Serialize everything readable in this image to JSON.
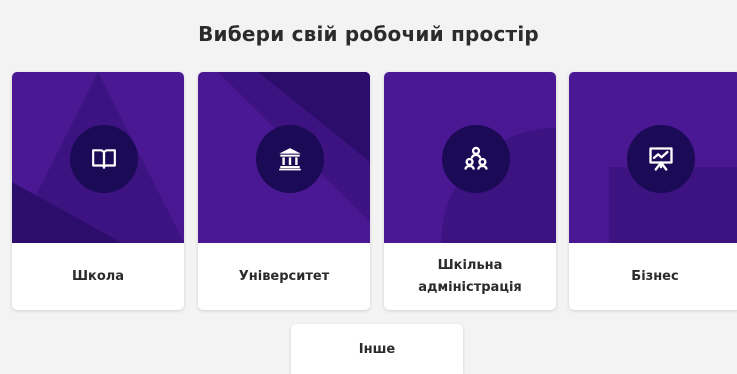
{
  "header": {
    "title": "Вибери свій робочий простір"
  },
  "workspaces": [
    {
      "label": "Школа",
      "icon": "book-icon"
    },
    {
      "label": "Університет",
      "icon": "university-building-icon"
    },
    {
      "label": "Шкільна адміністрація",
      "icon": "people-group-icon"
    },
    {
      "label": "Бізнес",
      "icon": "presentation-chart-icon"
    }
  ],
  "other": {
    "label": "Інше"
  },
  "colors": {
    "card_top": "#4a1893",
    "icon_circle": "#1b0a55",
    "background": "#f3f3f4"
  }
}
